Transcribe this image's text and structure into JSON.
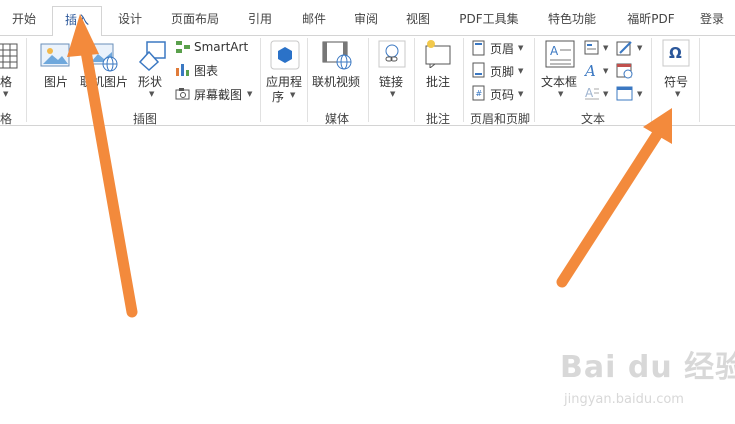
{
  "tabs": [
    {
      "label": "开始"
    },
    {
      "label": "插入",
      "active": true
    },
    {
      "label": "设计"
    },
    {
      "label": "页面布局"
    },
    {
      "label": "引用"
    },
    {
      "label": "邮件"
    },
    {
      "label": "审阅"
    },
    {
      "label": "视图"
    },
    {
      "label": "PDF工具集"
    },
    {
      "label": "特色功能"
    },
    {
      "label": "福昕PDF"
    }
  ],
  "login_label": "登录",
  "groups": {
    "table": {
      "label": "表格",
      "button": "表格"
    },
    "illustrations": {
      "label": "插图",
      "picture": "图片",
      "online_picture": "联机图片",
      "shapes": "形状",
      "smartart": "SmartArt",
      "chart": "图表",
      "screenshot": "屏幕截图"
    },
    "apps": {
      "label_line1": "应用程",
      "label_line2": "序"
    },
    "media": {
      "label": "媒体",
      "online_video": "联机视频"
    },
    "links": {
      "button": "链接"
    },
    "comments": {
      "label": "批注",
      "button": "批注"
    },
    "header_footer": {
      "label": "页眉和页脚",
      "header": "页眉",
      "footer": "页脚",
      "page_number": "页码"
    },
    "text": {
      "label": "文本",
      "textbox": "文本框"
    },
    "symbols": {
      "button": "符号"
    }
  },
  "watermark": {
    "logo": "Bai du 经验",
    "url": "jingyan.baidu.com"
  },
  "colors": {
    "accent": "#2b579a",
    "arrow": "#f38a3c"
  }
}
